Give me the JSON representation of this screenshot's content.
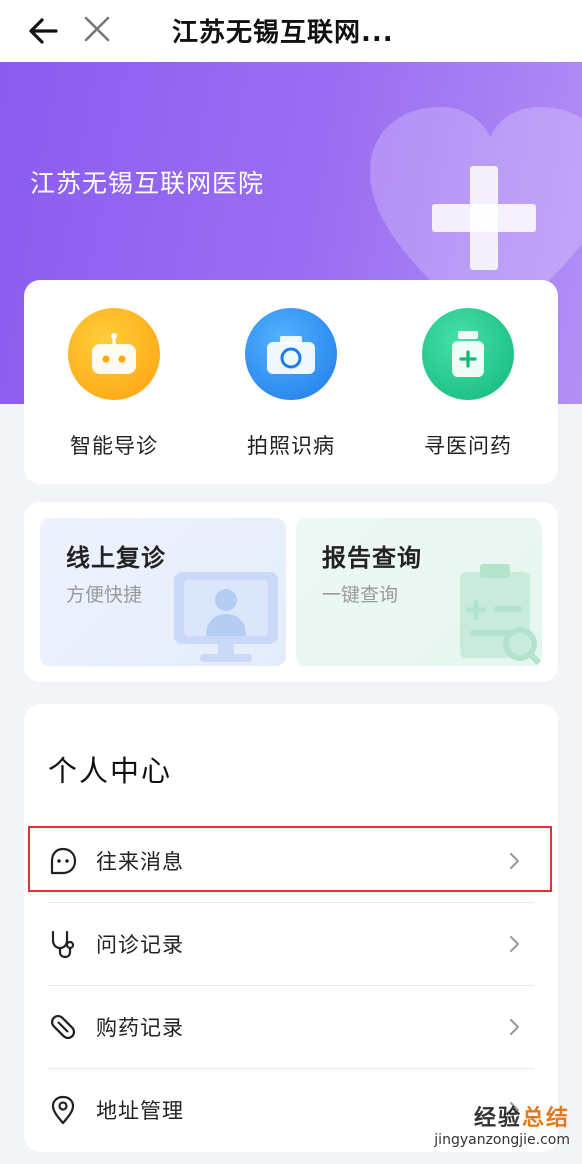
{
  "topbar": {
    "title": "江苏无锡互联网..."
  },
  "hero": {
    "hospital_name": "江苏无锡互联网医院"
  },
  "quick_actions": [
    {
      "label": "智能导诊",
      "icon": "robot-icon",
      "color": "#ffb21a"
    },
    {
      "label": "拍照识病",
      "icon": "camera-icon",
      "color": "#2f8cf0"
    },
    {
      "label": "寻医问药",
      "icon": "medicine-bottle-icon",
      "color": "#1fc98d"
    }
  ],
  "services": [
    {
      "title": "线上复诊",
      "subtitle": "方便快捷",
      "icon": "doctor-monitor-icon"
    },
    {
      "title": "报告查询",
      "subtitle": "一键查询",
      "icon": "report-search-icon"
    }
  ],
  "personal_center": {
    "title": "个人中心",
    "items": [
      {
        "label": "往来消息",
        "icon": "message-icon"
      },
      {
        "label": "问诊记录",
        "icon": "stethoscope-icon"
      },
      {
        "label": "购药记录",
        "icon": "pill-icon"
      },
      {
        "label": "地址管理",
        "icon": "location-icon"
      }
    ]
  },
  "watermark": {
    "line1_a": "经验",
    "line1_b": "总结",
    "line2": "jingyanzongjie.com"
  },
  "colors": {
    "hero_start": "#8a5cf0",
    "hero_end": "#b28ff6",
    "highlight": "#e03434"
  }
}
